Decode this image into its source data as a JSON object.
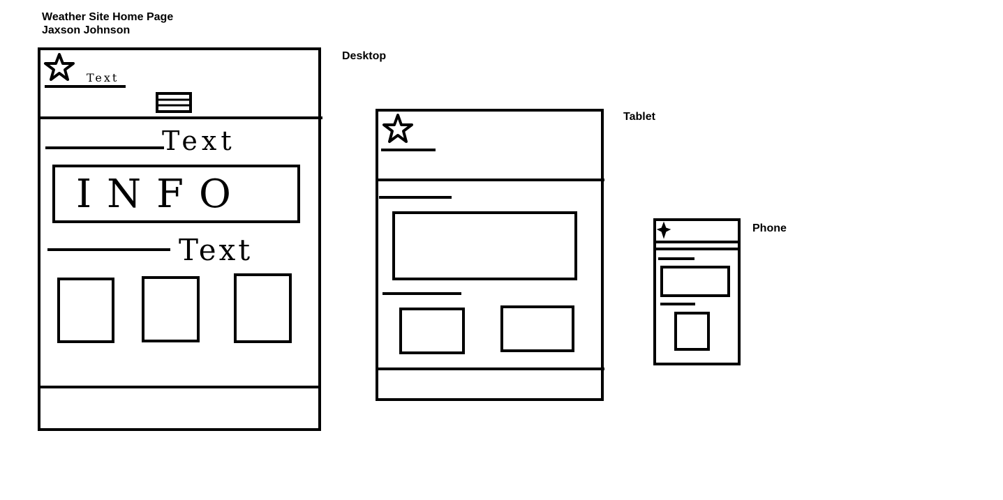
{
  "header": {
    "title": "Weather Site Home Page",
    "author": "Jaxson Johnson"
  },
  "wireframes": {
    "desktop": {
      "label": "Desktop",
      "logo_icon": "star-icon",
      "menu_icon": "hamburger-menu-icon",
      "header_text": "Text",
      "section1_text": "Text",
      "info_box_text": "INFO",
      "section2_text": "Text",
      "card_count": 3
    },
    "tablet": {
      "label": "Tablet",
      "logo_icon": "star-icon",
      "card_count": 2
    },
    "phone": {
      "label": "Phone",
      "logo_icon": "star-icon",
      "card_count": 1
    }
  }
}
